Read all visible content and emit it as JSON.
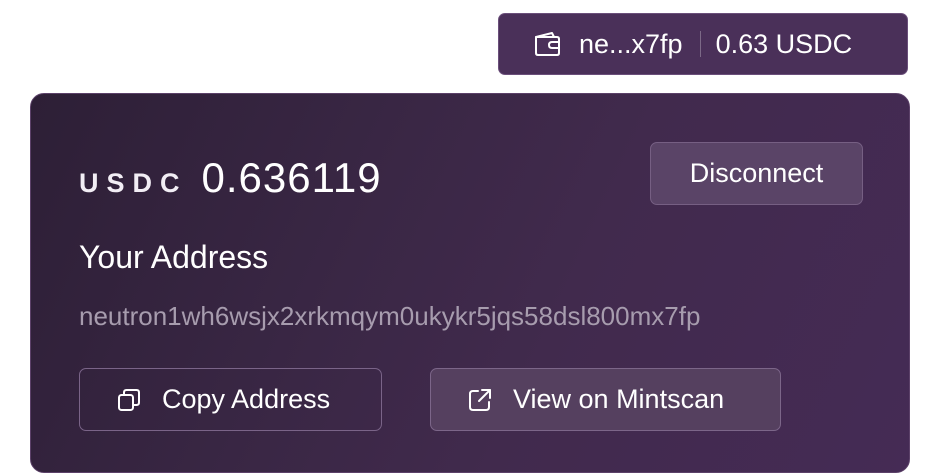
{
  "wallet": {
    "address_short": "ne...x7fp",
    "balance_label": "0.63 USDC",
    "icon": "wallet-icon"
  },
  "card": {
    "token_symbol": "USDC",
    "token_amount": "0.636119",
    "disconnect_label": "Disconnect",
    "address_heading": "Your Address",
    "address_full": "neutron1wh6wsjx2xrkmqym0ukykr5jqs58dsl800mx7fp",
    "copy_label": "Copy Address",
    "copy_icon": "copy-icon",
    "mintscan_label": "View on Mintscan",
    "mintscan_icon": "external-link-icon"
  },
  "colors": {
    "pill_bg": "#4a3059",
    "card_bg": "#3a2745",
    "muted_text": "#a79cae"
  }
}
